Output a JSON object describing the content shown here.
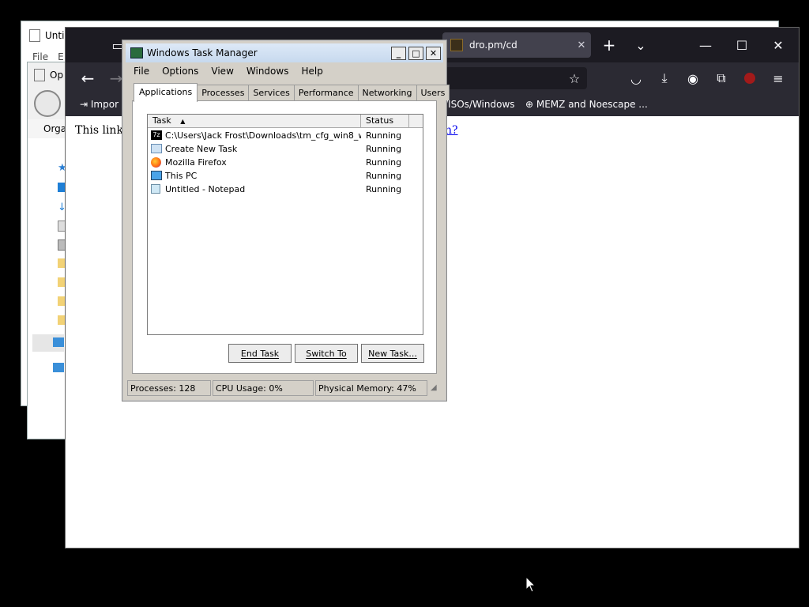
{
  "notepad": {
    "title": "Untitled - Notepad",
    "title_visible": "Unti",
    "menu_file": "File",
    "menu_edit": "E"
  },
  "explorer": {
    "title_visible": "Op",
    "organize": "Orga"
  },
  "firefox": {
    "tab_title": "dro.pm/cd",
    "content_text": "This link c",
    "content_link": "n?",
    "bookmarks": {
      "import": "Impor",
      "isos": "/ISOs/Windows",
      "memz": "MEMZ and Noescape ..."
    }
  },
  "task_manager": {
    "title": "Windows Task Manager",
    "menu": [
      "File",
      "Options",
      "View",
      "Windows",
      "Help"
    ],
    "tabs": [
      "Applications",
      "Processes",
      "Services",
      "Performance",
      "Networking",
      "Users"
    ],
    "columns": {
      "task": "Task",
      "status": "Status"
    },
    "rows": [
      {
        "task": "C:\\Users\\Jack Frost\\Downloads\\tm_cfg_win8_wi...",
        "status": "Running",
        "icon": "7zip-icon"
      },
      {
        "task": "Create New Task",
        "status": "Running",
        "icon": "run-icon"
      },
      {
        "task": "Mozilla Firefox",
        "status": "Running",
        "icon": "firefox-icon"
      },
      {
        "task": "This PC",
        "status": "Running",
        "icon": "computer-icon"
      },
      {
        "task": "Untitled - Notepad",
        "status": "Running",
        "icon": "notepad-icon"
      }
    ],
    "buttons": {
      "end_task": "End Task",
      "switch_to": "Switch To",
      "new_task": "New Task..."
    },
    "status": {
      "processes": "Processes: 128",
      "cpu": "CPU Usage: 0%",
      "memory": "Physical Memory: 47%"
    }
  },
  "colors": {
    "ff_dark": "#1c1b22",
    "ff_toolbar": "#2b2a33",
    "tm_face": "#d4d0c8",
    "link": "#0000ee"
  }
}
